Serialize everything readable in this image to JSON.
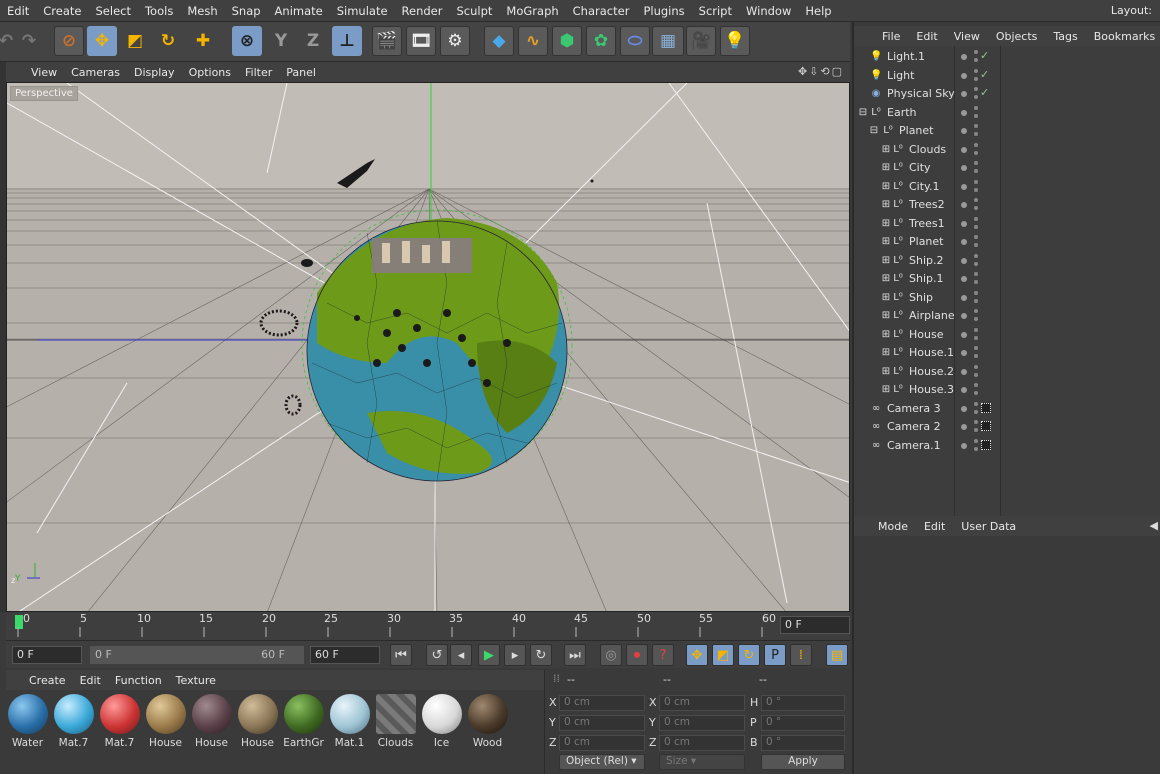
{
  "menubar": {
    "items": [
      "Edit",
      "Create",
      "Select",
      "Tools",
      "Mesh",
      "Snap",
      "Animate",
      "Simulate",
      "Render",
      "Sculpt",
      "MoGraph",
      "Character",
      "Plugins",
      "Script",
      "Window",
      "Help"
    ],
    "layout_label": "Layout:"
  },
  "toolbar": {
    "axis_y": "Y",
    "axis_z": "Z"
  },
  "viewport": {
    "menu": [
      "View",
      "Cameras",
      "Display",
      "Options",
      "Filter",
      "Panel"
    ],
    "label": "Perspective"
  },
  "timeline": {
    "ticks": [
      "0",
      "5",
      "10",
      "15",
      "20",
      "25",
      "30",
      "35",
      "40",
      "45",
      "50",
      "55",
      "60"
    ],
    "end_frame": "0 F"
  },
  "playback": {
    "start": "0 F",
    "range_start": "0 F",
    "range_end": "60 F",
    "end": "60 F"
  },
  "materials": {
    "menu": [
      "Create",
      "Edit",
      "Function",
      "Texture"
    ],
    "items": [
      {
        "name": "Water",
        "color": "#2a6fa8"
      },
      {
        "name": "Mat.7",
        "color": "#3aa8d8"
      },
      {
        "name": "Mat.7",
        "color": "#cc3333"
      },
      {
        "name": "House",
        "color": "#9a7a4a"
      },
      {
        "name": "House",
        "color": "#5a4048"
      },
      {
        "name": "House",
        "color": "#8a7656"
      },
      {
        "name": "EarthGr",
        "color": "#3f6a22"
      },
      {
        "name": "Mat.1",
        "color": "#9ec4d4"
      },
      {
        "name": "Clouds",
        "color": "#6a6a6a"
      },
      {
        "name": "Ice",
        "color": "#e8e8e8"
      },
      {
        "name": "Wood",
        "color": "#4a3a2a"
      }
    ]
  },
  "coords": {
    "headers": [
      "--",
      "--",
      "--"
    ],
    "rows": [
      {
        "l1": "X",
        "v1": "0 cm",
        "l2": "X",
        "v2": "0 cm",
        "l3": "H",
        "v3": "0 °"
      },
      {
        "l1": "Y",
        "v1": "0 cm",
        "l2": "Y",
        "v2": "0 cm",
        "l3": "P",
        "v3": "0 °"
      },
      {
        "l1": "Z",
        "v1": "0 cm",
        "l2": "Z",
        "v2": "0 cm",
        "l3": "B",
        "v3": "0 °"
      }
    ],
    "mode": "Object (Rel)",
    "size": "Size",
    "apply": "Apply"
  },
  "objects": {
    "menu": [
      "File",
      "Edit",
      "View",
      "Objects",
      "Tags",
      "Bookmarks"
    ],
    "items": [
      {
        "name": "Light.1",
        "indent": 0,
        "icon": "light-icon",
        "check": "✓"
      },
      {
        "name": "Light",
        "indent": 0,
        "icon": "light-icon",
        "check": "✓"
      },
      {
        "name": "Physical Sky",
        "indent": 0,
        "icon": "sky-icon",
        "check": "✓"
      },
      {
        "name": "Earth",
        "indent": 0,
        "icon": "null-icon",
        "check": ""
      },
      {
        "name": "Planet",
        "indent": 1,
        "icon": "null-icon",
        "check": ""
      },
      {
        "name": "Clouds",
        "indent": 2,
        "icon": "null-icon",
        "check": ""
      },
      {
        "name": "City",
        "indent": 2,
        "icon": "null-icon",
        "check": ""
      },
      {
        "name": "City.1",
        "indent": 2,
        "icon": "null-icon",
        "check": ""
      },
      {
        "name": "Trees2",
        "indent": 2,
        "icon": "null-icon",
        "check": ""
      },
      {
        "name": "Trees1",
        "indent": 2,
        "icon": "null-icon",
        "check": ""
      },
      {
        "name": "Planet",
        "indent": 2,
        "icon": "null-icon",
        "check": ""
      },
      {
        "name": "Ship.2",
        "indent": 2,
        "icon": "null-icon",
        "check": ""
      },
      {
        "name": "Ship.1",
        "indent": 2,
        "icon": "null-icon",
        "check": ""
      },
      {
        "name": "Ship",
        "indent": 2,
        "icon": "null-icon",
        "check": ""
      },
      {
        "name": "Airplane",
        "indent": 2,
        "icon": "null-icon",
        "check": ""
      },
      {
        "name": "House",
        "indent": 2,
        "icon": "null-icon",
        "check": ""
      },
      {
        "name": "House.1",
        "indent": 2,
        "icon": "null-icon",
        "check": ""
      },
      {
        "name": "House.2",
        "indent": 2,
        "icon": "null-icon",
        "check": ""
      },
      {
        "name": "House.3",
        "indent": 2,
        "icon": "null-icon",
        "check": ""
      },
      {
        "name": "Camera 3",
        "indent": 0,
        "icon": "camera-icon",
        "check": "tag"
      },
      {
        "name": "Camera 2",
        "indent": 0,
        "icon": "camera-icon",
        "check": "tag"
      },
      {
        "name": "Camera.1",
        "indent": 0,
        "icon": "camera-icon",
        "check": "tag"
      }
    ]
  },
  "attributes": {
    "menu": [
      "Mode",
      "Edit",
      "User Data"
    ]
  }
}
